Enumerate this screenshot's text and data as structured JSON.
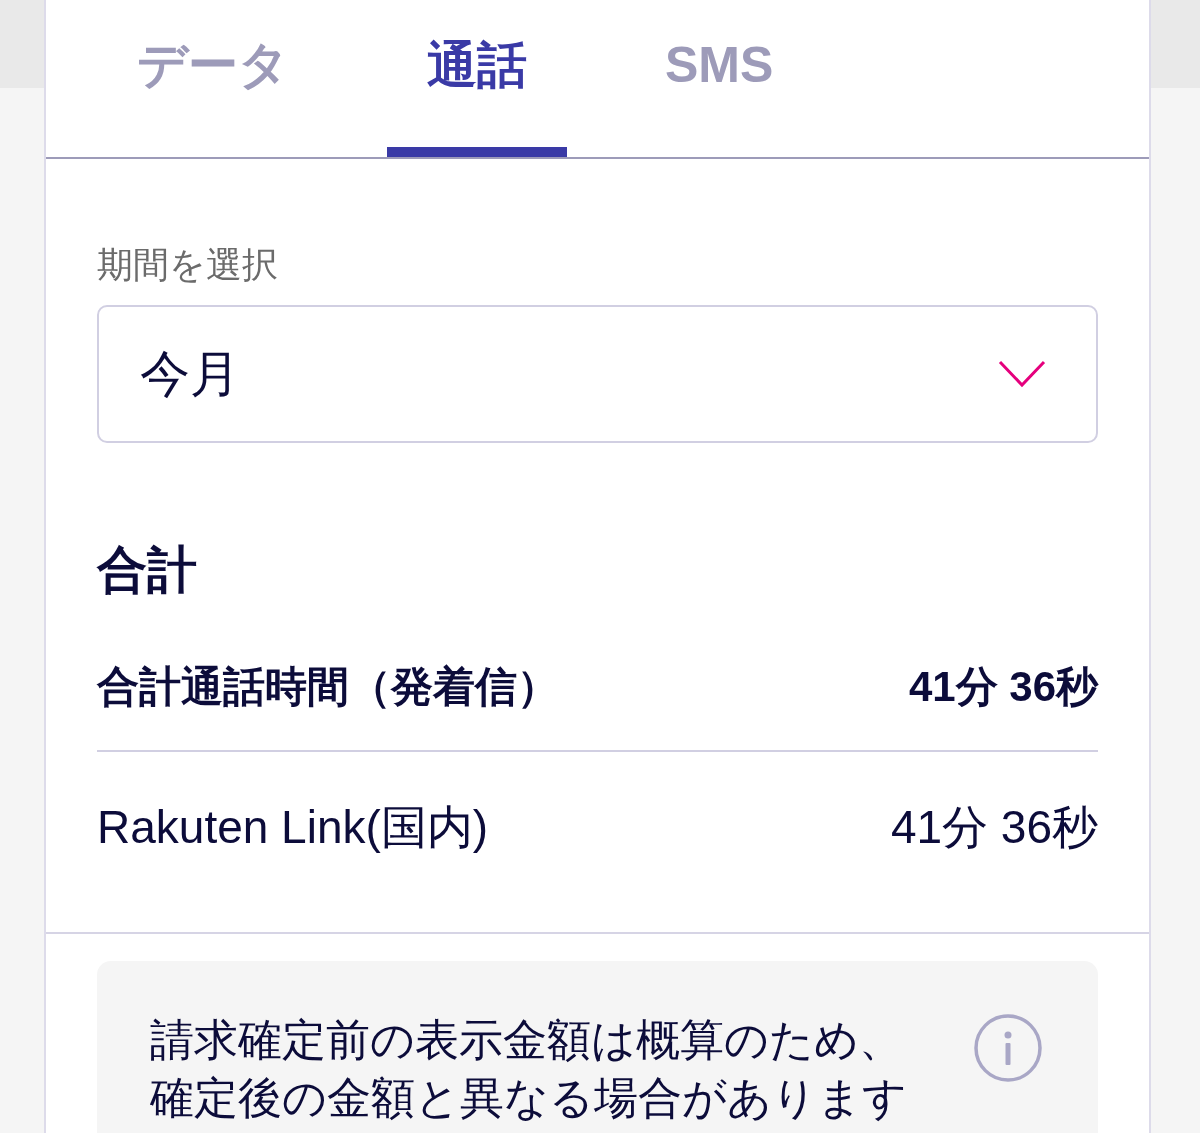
{
  "tabs": [
    {
      "label": "データ",
      "selected": false
    },
    {
      "label": "通話",
      "selected": true
    },
    {
      "label": "SMS",
      "selected": false
    }
  ],
  "period": {
    "label": "期間を選択",
    "value": "今月"
  },
  "summary": {
    "heading": "合計",
    "rows": [
      {
        "kind": "total",
        "label": "合計通話時間（発着信）",
        "value": "41分 36秒"
      },
      {
        "kind": "item",
        "label": "Rakuten Link(国内)",
        "value": "41分 36秒"
      }
    ]
  },
  "notice": {
    "lines": [
      "請求確定前の表示金額は概算のため、",
      "確定後の金額と異なる場合があります"
    ]
  }
}
